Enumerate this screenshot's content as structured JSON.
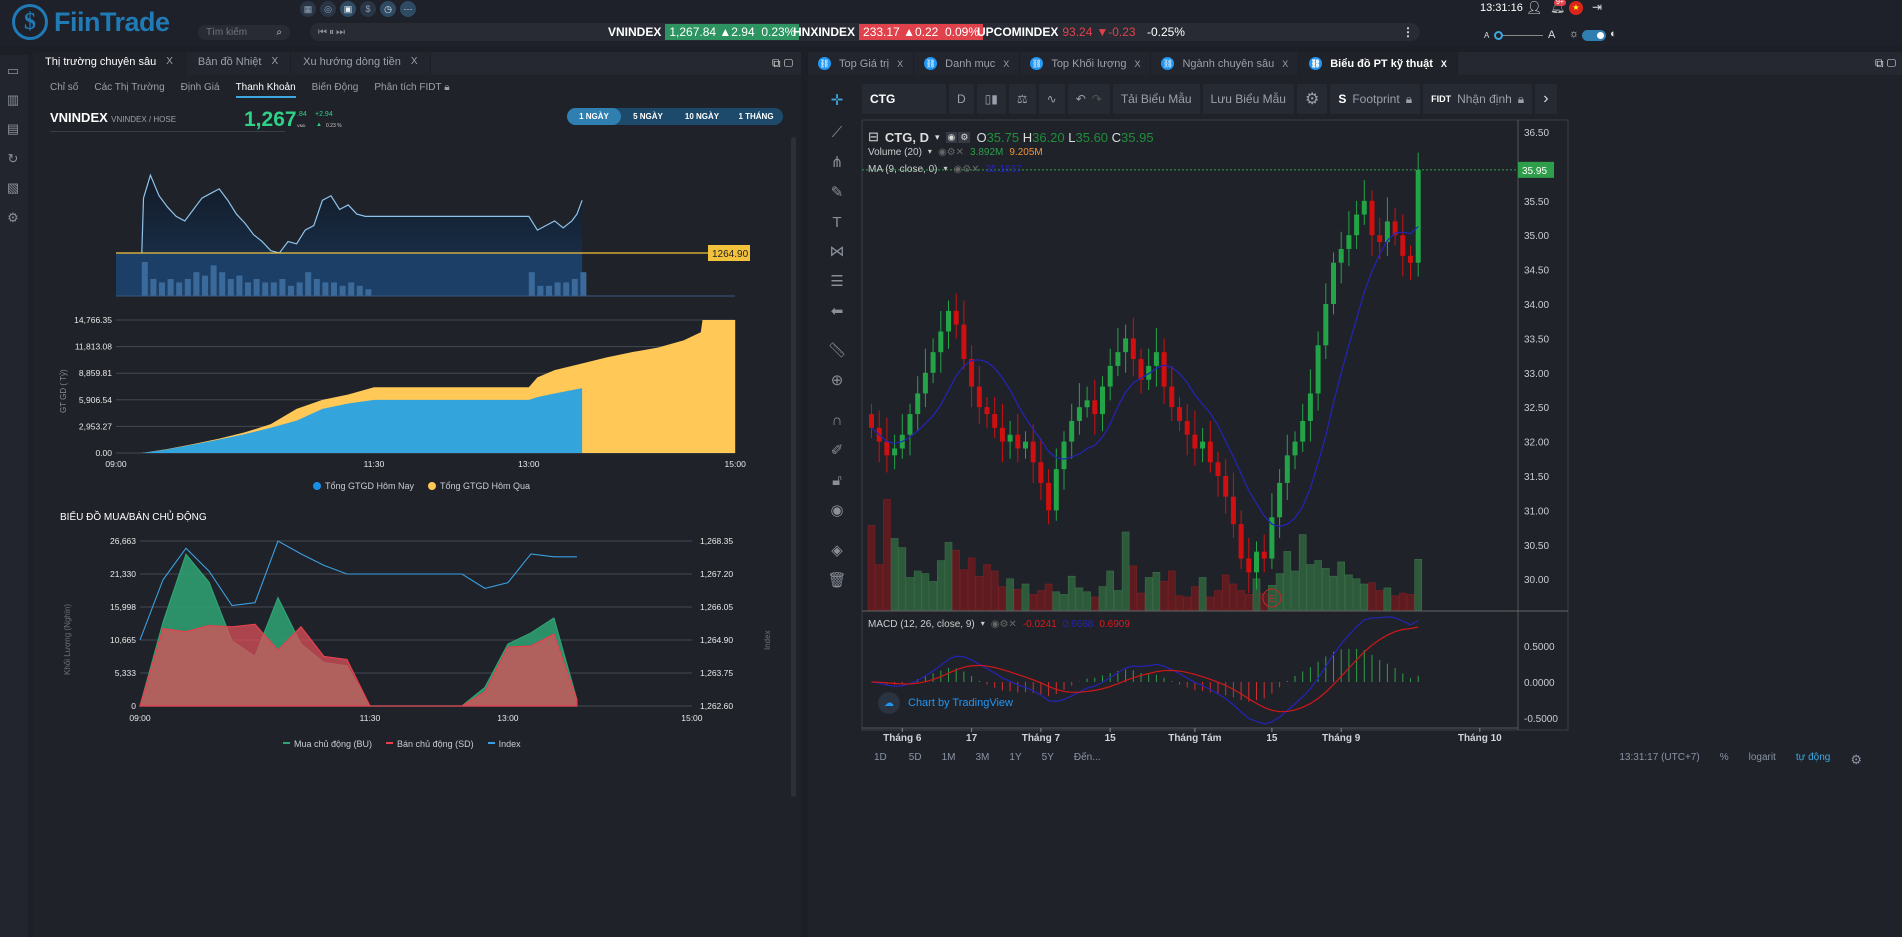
{
  "header": {
    "logo": "FiinTrade",
    "search_placeholder": "Tìm kiếm",
    "quick_icons": [
      "table-icon",
      "search-chart-icon",
      "calendar-icon",
      "coin-icon",
      "clock-icon",
      "more-icon"
    ],
    "tickers": [
      {
        "name": "VNINDEX",
        "value": "1,267.84",
        "change": "▲2.94",
        "pct": "0.23%",
        "status": "up",
        "color": "#2d9360"
      },
      {
        "name": "HNXINDEX",
        "value": "233.17",
        "change": "▲0.22",
        "pct": "0.09%",
        "status": "up-highlight",
        "color": "#e0424c"
      },
      {
        "name": "UPCOMINDEX",
        "value": "93.24",
        "change": "▼-0.23",
        "pct": "-0.25%",
        "status": "down",
        "color": "#e0424c"
      }
    ],
    "time": "13:31:16",
    "notif_badge": "9+",
    "font_small": "A",
    "font_large": "A"
  },
  "left": {
    "tabs": [
      {
        "label": "Thị trường chuyên sâu",
        "active": true
      },
      {
        "label": "Bản đồ Nhiệt"
      },
      {
        "label": "Xu hướng dòng tiền"
      }
    ],
    "close": "X",
    "subtabs": [
      "Chỉ số",
      "Các Thị Trường",
      "Định Giá",
      "Thanh Khoản",
      "Biến Động",
      "Phân tích FIDT"
    ],
    "active_subtab": "Thanh Khoản",
    "index": {
      "name": "VNINDEX",
      "sub": "VNINDEX / HOSE",
      "price_int": "1,267",
      "price_dec": ".84",
      "unit": "VND",
      "change": "+2.94",
      "pct": "0.23 %"
    },
    "ranges": [
      "1 NGÀY",
      "5 NGÀY",
      "10 NGÀY",
      "1 THÁNG"
    ],
    "active_range": "1 NGÀY",
    "ref_label": "1264.90",
    "section_title": "BIỂU ĐỒ MUA/BÁN CHỦ ĐỘNG"
  },
  "chart_data": [
    {
      "type": "line",
      "id": "intraday-index",
      "reference": 1264.9,
      "times": [
        "09:15",
        "09:16",
        "09:20",
        "09:25",
        "09:30",
        "09:35",
        "09:40",
        "09:45",
        "09:50",
        "09:55",
        "10:00",
        "10:05",
        "10:10",
        "10:15",
        "10:20",
        "10:25",
        "10:30",
        "10:35",
        "10:40",
        "10:45",
        "10:50",
        "10:55",
        "11:00",
        "11:05",
        "11:10",
        "11:15",
        "11:20",
        "11:25",
        "11:30",
        "13:00",
        "13:05",
        "13:10",
        "13:15",
        "13:20",
        "13:25",
        "13:28",
        "13:31"
      ],
      "values": [
        1264.9,
        1267.3,
        1268.3,
        1267.4,
        1266.9,
        1266.5,
        1266.3,
        1266.8,
        1267.3,
        1267.5,
        1267.7,
        1267.2,
        1266.6,
        1266.2,
        1265.7,
        1265.4,
        1265.0,
        1264.9,
        1265.4,
        1265.3,
        1265.9,
        1266.1,
        1267.2,
        1267.4,
        1266.8,
        1267.0,
        1266.6,
        1266.5,
        1266.5,
        1266.5,
        1265.9,
        1266.1,
        1266.3,
        1266.0,
        1266.3,
        1266.6,
        1267.2
      ],
      "volume_times": [
        "09:15",
        "09:20",
        "09:25",
        "09:30",
        "09:35",
        "09:40",
        "09:45",
        "09:50",
        "09:55",
        "10:00",
        "10:05",
        "10:10",
        "10:15",
        "10:20",
        "10:25",
        "10:30",
        "10:35",
        "10:40",
        "10:45",
        "10:50",
        "10:55",
        "11:00",
        "11:05",
        "11:10",
        "11:15",
        "11:20",
        "11:25",
        "13:00",
        "13:05",
        "13:10",
        "13:15",
        "13:20",
        "13:25",
        "13:30"
      ],
      "volume": [
        10,
        5,
        4,
        5,
        4,
        5,
        7,
        6,
        9,
        7,
        5,
        6,
        4,
        5,
        4,
        4,
        5,
        3,
        4,
        7,
        5,
        4,
        4,
        3,
        4,
        3,
        2,
        7,
        3,
        3,
        4,
        4,
        5,
        7
      ]
    },
    {
      "type": "area",
      "id": "gtgd",
      "ylabel": "GT GD ( Tỷ)",
      "yticks": [
        "0.00",
        "2,953.27",
        "5,906.54",
        "8,859.81",
        "11,813.08",
        "14,766.35"
      ],
      "ylim": [
        0,
        14766.35
      ],
      "xticks": [
        "09:00",
        "11:30",
        "13:00",
        "15:00"
      ],
      "series": [
        {
          "name": "Tổng GTGD Hôm Qua",
          "color": "#ffc857",
          "times": [
            "09:15",
            "09:30",
            "09:45",
            "10:00",
            "10:15",
            "10:30",
            "10:45",
            "11:00",
            "11:15",
            "11:30",
            "13:00",
            "13:05",
            "13:15",
            "13:30",
            "13:45",
            "14:00",
            "14:15",
            "14:30",
            "14:40",
            "14:41",
            "15:00"
          ],
          "values": [
            0,
            450,
            1000,
            1600,
            2300,
            3200,
            4900,
            5900,
            6500,
            7300,
            7300,
            8400,
            9200,
            9900,
            10600,
            11200,
            11700,
            12500,
            13400,
            14766.35,
            14766.35
          ]
        },
        {
          "name": "Tổng GTGD Hôm Nay",
          "color": "#34a4dd",
          "times": [
            "09:15",
            "09:30",
            "09:45",
            "10:00",
            "10:15",
            "10:30",
            "10:45",
            "11:00",
            "11:15",
            "11:30",
            "13:00",
            "13:05",
            "13:15",
            "13:31"
          ],
          "values": [
            0,
            420,
            950,
            1500,
            2100,
            2800,
            3600,
            4900,
            5500,
            5900,
            5900,
            6200,
            6600,
            7200
          ]
        }
      ]
    },
    {
      "type": "area",
      "id": "active-buy-sell",
      "ylabel": "Khối Lượng (Nghìn)",
      "y2label": "Index",
      "yticks": [
        "0",
        "5,333",
        "10,665",
        "15,998",
        "21,330",
        "26,663"
      ],
      "ylim": [
        0,
        26663
      ],
      "y2ticks": [
        "1,262.60",
        "1,263.75",
        "1,264.90",
        "1,266.05",
        "1,267.20",
        "1,268.35"
      ],
      "y2lim": [
        1262.6,
        1268.35
      ],
      "xticks": [
        "09:00",
        "11:30",
        "13:00",
        "15:00"
      ],
      "times": [
        "09:00",
        "09:15",
        "09:30",
        "09:45",
        "10:00",
        "10:15",
        "10:30",
        "10:45",
        "11:00",
        "11:15",
        "11:30",
        "11:45",
        "12:00",
        "12:15",
        "12:30",
        "12:45",
        "13:00",
        "13:15",
        "13:30",
        "13:45"
      ],
      "series": [
        {
          "name": "Mua chủ động (BU)",
          "color": "#2fa374",
          "values": [
            0,
            13500,
            24500,
            20000,
            10500,
            8000,
            17500,
            10000,
            7000,
            6500,
            0,
            0,
            0,
            0,
            0,
            3000,
            10000,
            11800,
            14200,
            1000
          ]
        },
        {
          "name": "Bán chủ động (SD)",
          "color": "#e8404f",
          "values": [
            0,
            12500,
            12000,
            13000,
            12800,
            13200,
            9000,
            12800,
            8000,
            7500,
            0,
            0,
            0,
            0,
            0,
            2300,
            9500,
            9700,
            11600,
            1000
          ]
        },
        {
          "name": "Index",
          "color": "#3a9fe0",
          "values": [
            1264.9,
            1267.0,
            1268.1,
            1267.3,
            1266.1,
            1266.2,
            1268.35,
            1267.9,
            1267.5,
            1267.2,
            1267.2,
            1267.2,
            1267.2,
            1267.2,
            1267.2,
            1266.7,
            1266.9,
            1267.9,
            1267.8,
            1267.8
          ]
        }
      ]
    },
    {
      "type": "candlestick",
      "id": "ctg-daily",
      "symbol": "CTG",
      "interval": "D",
      "yticks": [
        "30.00",
        "30.50",
        "31.00",
        "31.50",
        "32.00",
        "32.50",
        "33.00",
        "33.50",
        "34.00",
        "34.50",
        "35.00",
        "35.50",
        "36.00",
        "36.50"
      ],
      "ylim": [
        29.6,
        36.6
      ],
      "last_price": "35.95",
      "close": [
        32.2,
        32.0,
        31.8,
        31.9,
        32.1,
        32.4,
        32.7,
        33.0,
        33.3,
        33.6,
        33.9,
        33.7,
        33.2,
        32.8,
        32.5,
        32.4,
        32.2,
        32.0,
        32.1,
        31.9,
        32.0,
        31.7,
        31.4,
        31.0,
        31.6,
        32.0,
        32.3,
        32.5,
        32.6,
        32.4,
        32.8,
        33.1,
        33.3,
        33.5,
        33.2,
        32.9,
        33.1,
        33.3,
        32.8,
        32.5,
        32.3,
        32.1,
        31.9,
        32.0,
        31.7,
        31.5,
        31.2,
        30.8,
        30.3,
        30.1,
        30.4,
        30.3,
        30.9,
        31.4,
        31.8,
        32.0,
        32.3,
        32.7,
        33.4,
        34.0,
        34.6,
        34.8,
        35.0,
        35.3,
        35.5,
        35.0,
        34.9,
        35.2,
        35.0,
        34.7,
        34.6,
        35.95
      ],
      "volume_m": [
        6.5,
        3.5,
        8.5,
        5.5,
        4.8,
        2.5,
        3.0,
        2.8,
        2.2,
        3.8,
        5.2,
        4.6,
        3.1,
        4.0,
        2.6,
        3.5,
        3.0,
        1.8,
        2.4,
        1.6,
        2.0,
        1.2,
        1.5,
        2.0,
        1.4,
        1.2,
        2.6,
        1.7,
        1.4,
        1.0,
        1.8,
        3.0,
        1.5,
        6.0,
        3.4,
        1.3,
        2.5,
        2.9,
        2.2,
        3.0,
        1.1,
        1.0,
        1.8,
        2.5,
        1.0,
        1.5,
        2.7,
        2.0,
        1.5,
        1.2,
        2.4,
        1.3,
        1.9,
        2.8,
        4.5,
        3.0,
        5.8,
        3.5,
        3.8,
        3.2,
        2.6,
        3.7,
        2.7,
        2.4,
        2.0,
        2.1,
        1.5,
        1.7,
        1.1,
        1.3,
        1.2,
        3.9
      ],
      "macd_yticks": [
        "-0.5000",
        "0.0000",
        "0.5000"
      ],
      "xticks": [
        {
          "label": "Tháng 6",
          "bar": 4
        },
        {
          "label": "17",
          "bar": 13
        },
        {
          "label": "Tháng 7",
          "bar": 22
        },
        {
          "label": "15",
          "bar": 31
        },
        {
          "label": "Tháng Tám",
          "bar": 42
        },
        {
          "label": "15",
          "bar": 52
        },
        {
          "label": "Tháng 9",
          "bar": 61
        },
        {
          "label": "Tháng 10",
          "bar": 79
        }
      ]
    }
  ],
  "right": {
    "tabs": [
      {
        "label": "Top Giá trị"
      },
      {
        "label": "Danh mục"
      },
      {
        "label": "Top Khối lượng"
      },
      {
        "label": "Ngành chuyên sâu"
      },
      {
        "label": "Biểu đồ PT kỹ thuật",
        "active": true
      }
    ],
    "close": "X",
    "toolbar": {
      "symbol": "CTG",
      "interval": "D",
      "load": "Tải Biểu Mẫu",
      "save": "Lưu Biểu Mẫu",
      "footprint": "Footprint",
      "fidt": "FIDT",
      "insight": "Nhận định"
    },
    "legend": {
      "title": "CTG, D",
      "o": "35.75",
      "h": "36.20",
      "l": "35.60",
      "c": "35.95",
      "volume": "Volume (20)",
      "vol1": "3.892M",
      "vol2": "9.205M",
      "ma": "MA (9, close, 0)",
      "ma_val": "35.1667",
      "macd": "MACD (12, 26, close, 9)",
      "macd1": "-0.0241",
      "macd2": "0.6668",
      "macd3": "0.6909"
    },
    "watermark": "Chart by TradingView",
    "marker": "E",
    "periods": [
      "1D",
      "5D",
      "1M",
      "3M",
      "1Y",
      "5Y",
      "Đến..."
    ],
    "time": "13:31:17 (UTC+7)",
    "pct": "%",
    "log": "logarit",
    "auto": "tự động",
    "colors": {
      "up": "#22a447",
      "down": "#d01010",
      "ma": "#2424b8",
      "accent": "#2196f3"
    }
  }
}
